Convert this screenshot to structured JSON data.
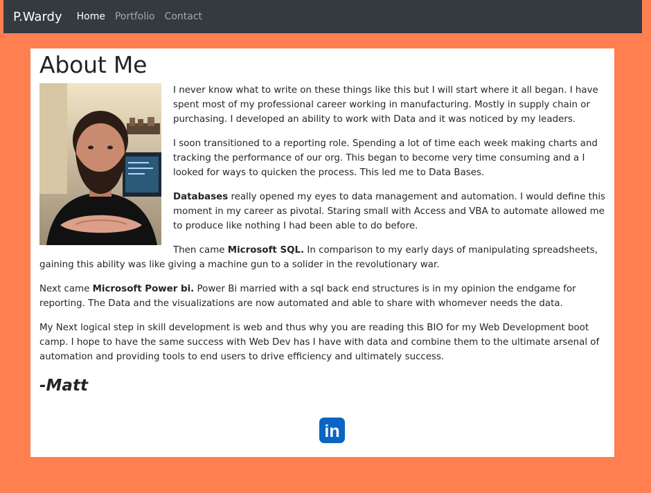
{
  "nav": {
    "brand": "P.Wardy",
    "links": [
      {
        "label": "Home",
        "active": true
      },
      {
        "label": "Portfolio",
        "active": false
      },
      {
        "label": "Contact",
        "active": false
      }
    ]
  },
  "about": {
    "title": "About Me",
    "photo_icon": "profile-photo",
    "p1": "I never know what to write on these things like this but I will start where it all began. I have spent most of my professional career working in manufacturing. Mostly in supply chain or purchasing. I developed an ability to work with Data and it was noticed by my leaders.",
    "p2": "I soon transitioned to a reporting role. Spending a lot of time each week making charts and tracking the performance of our org. This began to become very time consuming and a I looked for ways to quicken the process. This led me to Data Bases.",
    "p3_bold": "Databases",
    "p3_rest": " really opened my eyes to data management and automation. I would define this moment in my career as pivotal. Staring small with Access and VBA to automate allowed me to produce like nothing I had been able to do before.",
    "p4_pre": "Then came ",
    "p4_bold": "Microsoft SQL.",
    "p4_rest": " In comparison to my early days of manipulating spreadsheets, gaining this ability was like giving a machine gun to a solider in the revolutionary war.",
    "p5_pre": "Next came ",
    "p5_bold": "Microsoft Power bi.",
    "p5_rest": " Power Bi married with a sql back end structures is in my opinion the endgame for reporting. The Data and the visualizations are now automated and able to share with whomever needs the data.",
    "p6": "My Next logical step in skill development is web and thus why you are reading this BIO for my Web Development boot camp. I hope to have the same success with Web Dev has I have with data and combine them to the ultimate arsenal of automation and providing tools to end users to drive efficiency and ultimately success.",
    "signature": "-Matt"
  },
  "social": {
    "icon": "linkedin-icon",
    "linkedin_text": "in"
  },
  "colors": {
    "page_bg": "#ff7f50",
    "navbar_bg": "#343a40",
    "linkedin_blue": "#0a66c2"
  }
}
